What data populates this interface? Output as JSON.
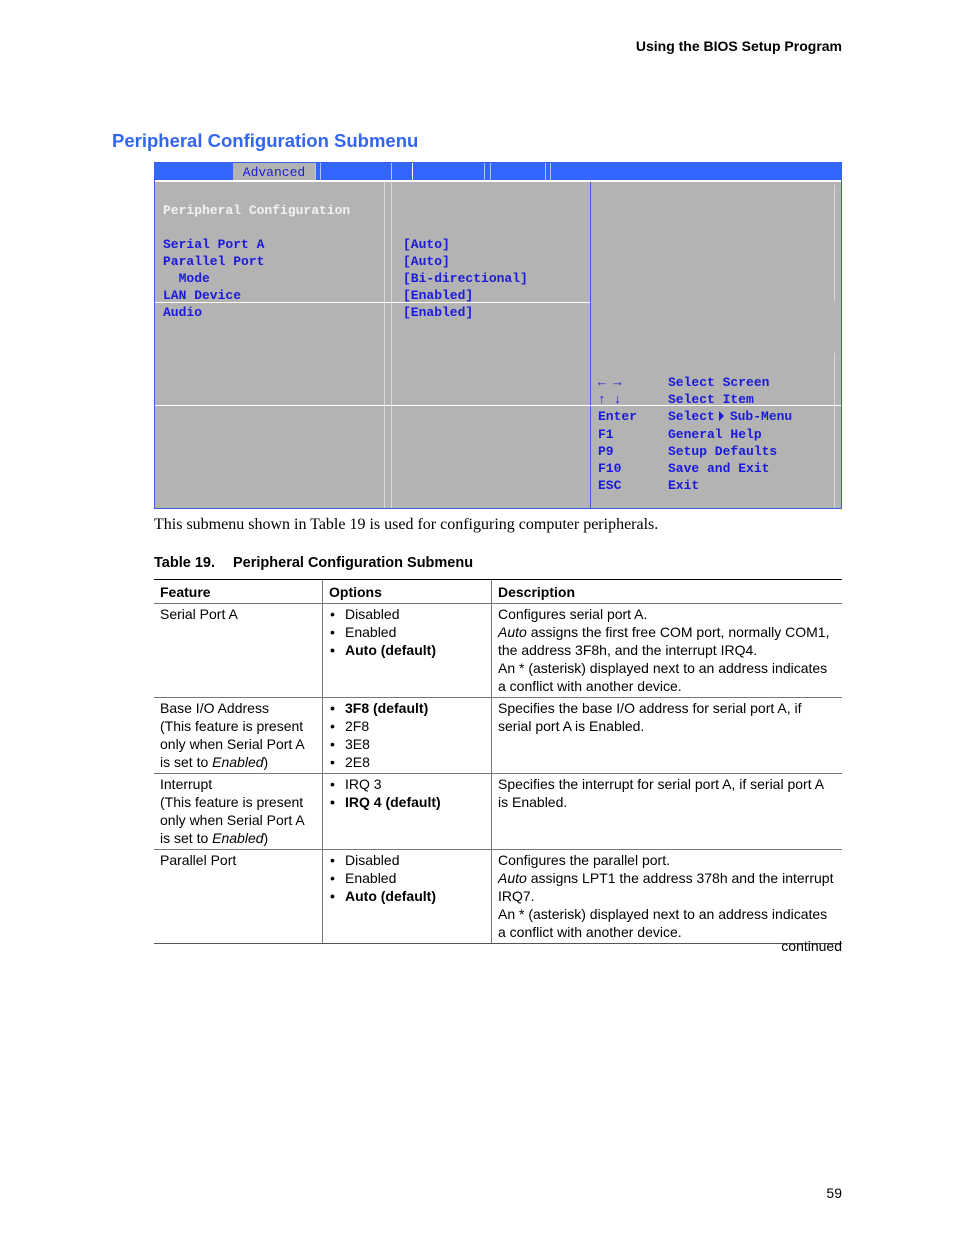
{
  "header": {
    "running_title": "Using the BIOS Setup Program"
  },
  "section": {
    "title": "Peripheral Configuration Submenu"
  },
  "bios_screen": {
    "active_tab": "Advanced",
    "heading": "Peripheral Configuration",
    "items": [
      {
        "label": "Serial Port A",
        "value": "[Auto]"
      },
      {
        "label": "Parallel Port",
        "value": "[Auto]"
      },
      {
        "label": "  Mode",
        "value": "[Bi-directional]"
      },
      {
        "label": "LAN Device",
        "value": "[Enabled]"
      },
      {
        "label": "Audio",
        "value": "[Enabled]"
      }
    ],
    "key_help": [
      {
        "key": "← →",
        "action": "Select Screen"
      },
      {
        "key": "↑ ↓",
        "action": "Select Item"
      },
      {
        "key": "Enter",
        "action_pre": "Select",
        "action_post": "Sub-Menu",
        "icon": "triangle-right-icon"
      },
      {
        "key": "F1",
        "action": "General Help"
      },
      {
        "key": "P9",
        "action": "Setup Defaults"
      },
      {
        "key": "F10",
        "action": "Save and Exit"
      },
      {
        "key": "ESC",
        "action": "Exit"
      }
    ],
    "colors": {
      "menubar": "#3366ff",
      "background": "#b3b3b3",
      "text": "#1a1adc",
      "heading": "#f2f2f2"
    }
  },
  "intro_text": "This submenu shown in Table 19 is used for configuring computer peripherals.",
  "table": {
    "caption_number": "Table 19.",
    "caption_title": "Peripheral Configuration Submenu",
    "headers": [
      "Feature",
      "Options",
      "Description"
    ],
    "rows": [
      {
        "feature": [
          "Serial Port A"
        ],
        "options": [
          {
            "text": "Disabled",
            "bold": false
          },
          {
            "text": "Enabled",
            "bold": false
          },
          {
            "text": "Auto (default)",
            "bold": true
          }
        ],
        "description": [
          "Configures serial port A.",
          "Auto assigns the first free COM port, normally COM1, the address 3F8h, and the interrupt IRQ4.",
          "An * (asterisk) displayed next to an address indicates a conflict with another device."
        ]
      },
      {
        "feature": [
          "Base I/O Address",
          "(This feature is present only when Serial Port A is set to Enabled)"
        ],
        "options": [
          {
            "text": "3F8 (default)",
            "bold": true
          },
          {
            "text": "2F8",
            "bold": false
          },
          {
            "text": "3E8",
            "bold": false
          },
          {
            "text": "2E8",
            "bold": false
          }
        ],
        "description": [
          "Specifies the base I/O address for serial port A, if serial port A is Enabled."
        ]
      },
      {
        "feature": [
          "Interrupt",
          "(This feature is present only when Serial Port A is set to Enabled)"
        ],
        "options": [
          {
            "text": "IRQ 3",
            "bold": false
          },
          {
            "text": "IRQ 4 (default)",
            "bold": true
          }
        ],
        "description": [
          "Specifies the interrupt for serial port A, if serial port A is Enabled."
        ]
      },
      {
        "feature": [
          "Parallel Port"
        ],
        "options": [
          {
            "text": "Disabled",
            "bold": false
          },
          {
            "text": "Enabled",
            "bold": false
          },
          {
            "text": "Auto (default)",
            "bold": true
          }
        ],
        "description": [
          "Configures the parallel port.",
          "Auto assigns LPT1 the address 378h and the interrupt IRQ7.",
          "An * (asterisk) displayed next to an address indicates a conflict with another device."
        ]
      }
    ],
    "continued_label": "continued"
  },
  "footer": {
    "page_number": "59"
  }
}
